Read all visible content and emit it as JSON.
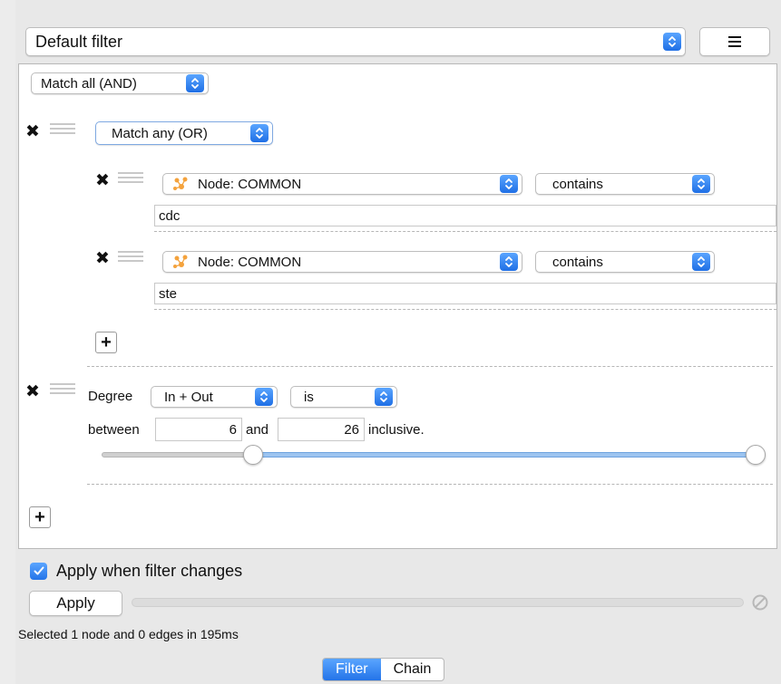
{
  "filter_select": {
    "value": "Default filter"
  },
  "menu_button": {
    "icon": "hamburger-menu-icon"
  },
  "root_match": {
    "value": "Match all (AND)"
  },
  "any_group": {
    "match": "Match any (OR)",
    "conditions": [
      {
        "column": "Node: COMMON",
        "operator": "contains",
        "text": "cdc"
      },
      {
        "column": "Node: COMMON",
        "operator": "contains",
        "text": "ste"
      }
    ]
  },
  "degree": {
    "label": "Degree",
    "direction": "In + Out",
    "operator": "is",
    "between_label": "between",
    "min": "6",
    "and_label": "and",
    "max": "26",
    "inclusive_label": "inclusive.",
    "range_fraction": [
      0.22,
      1.0
    ]
  },
  "apply_when_changes": {
    "label": "Apply when filter changes",
    "checked": true
  },
  "apply_button": {
    "label": "Apply"
  },
  "status": {
    "text": "Selected 1 node and 0 edges in 195ms"
  },
  "tabs": [
    {
      "label": "Filter",
      "active": true
    },
    {
      "label": "Chain",
      "active": false
    }
  ],
  "colors": {
    "accent": "#2f80ed",
    "slider_fill": "#9cc4f0",
    "node_icon": "#f4a23c"
  }
}
